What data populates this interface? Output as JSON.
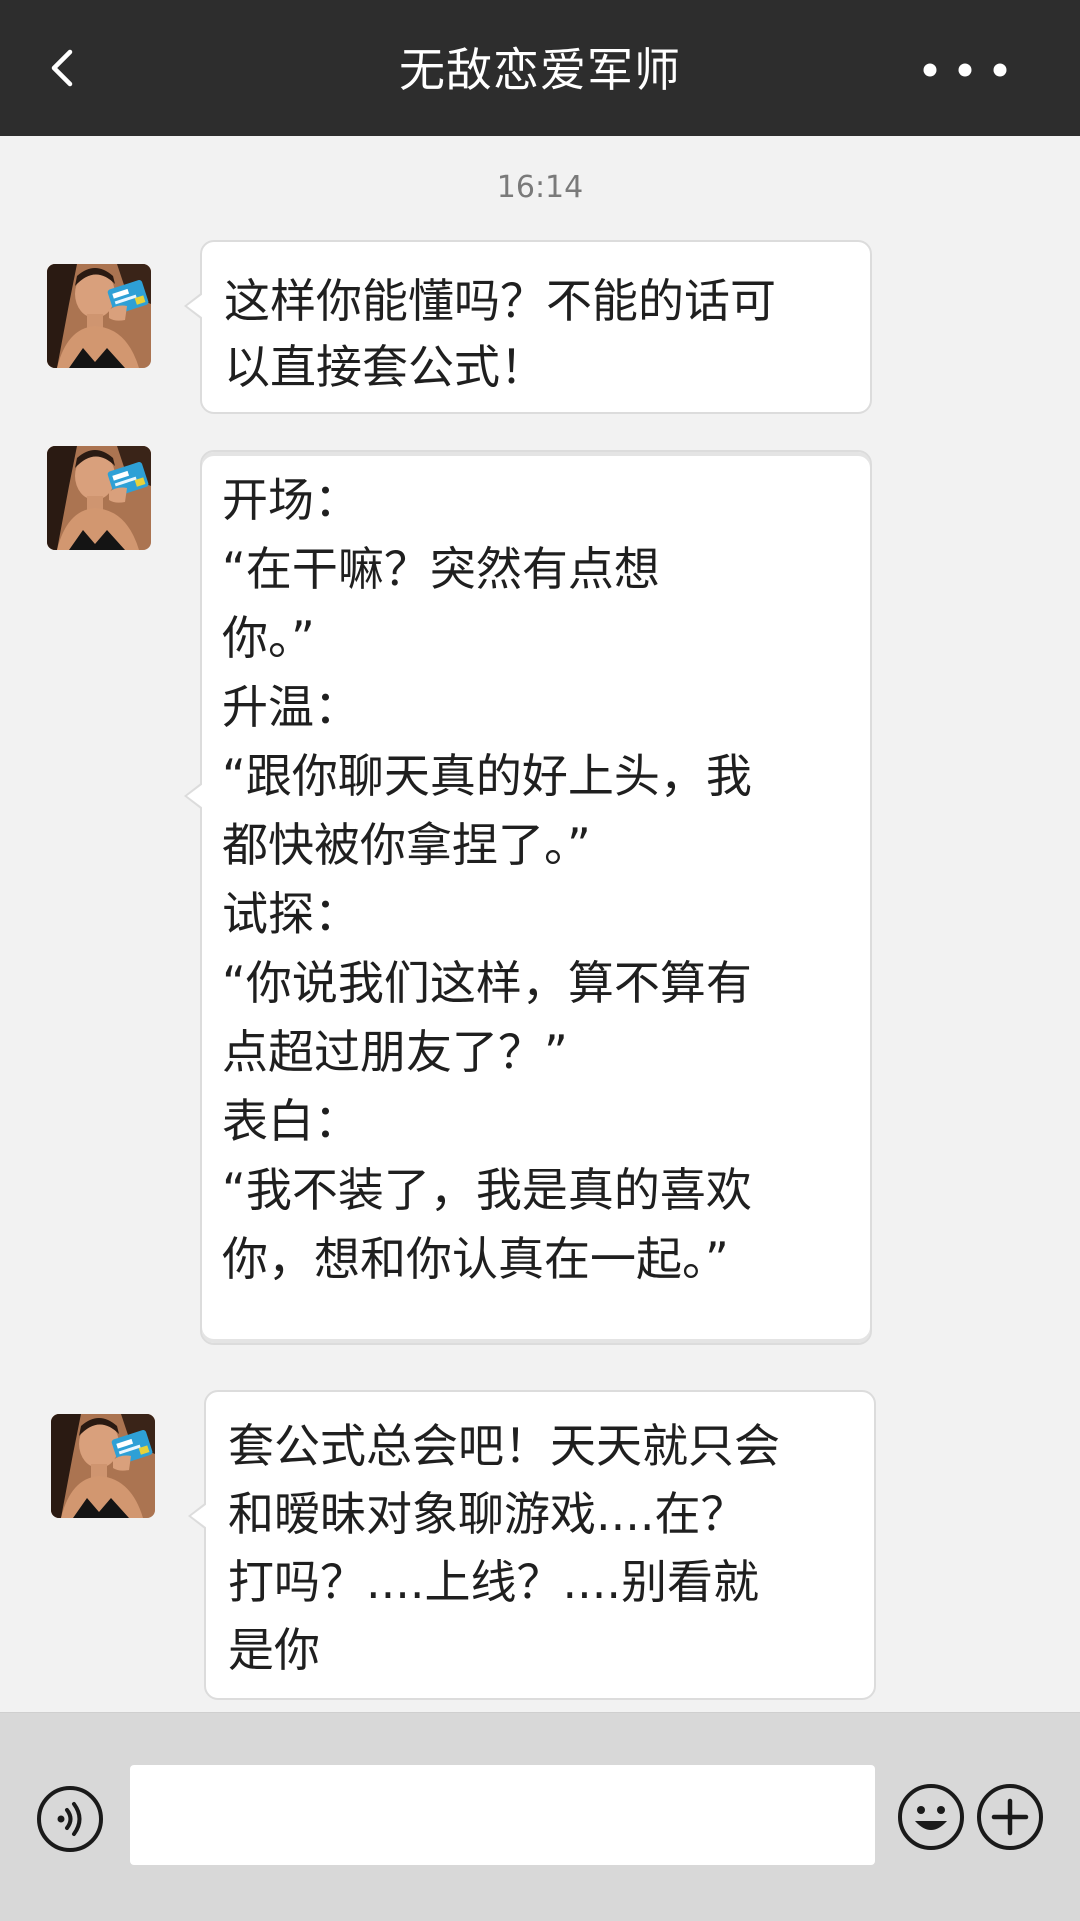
{
  "header": {
    "title": "无敌恋爱军师",
    "back_icon": "chevron-left-icon",
    "more_icon": "more-dots-icon"
  },
  "chat": {
    "timestamp": "16:14",
    "messages": [
      {
        "sender": "contact",
        "lines": [
          "这样你能懂吗？不能的话可",
          "以直接套公式！"
        ]
      },
      {
        "sender": "contact",
        "lines": [
          "开场：",
          "“在干嘛？突然有点想",
          "你。”",
          "升温：",
          "“跟你聊天真的好上头，我",
          "都快被你拿捏了。”",
          "试探：",
          "“你说我们这样，算不算有",
          "点超过朋友了？”",
          "表白：",
          "“我不装了，我是真的喜欢",
          "你，想和你认真在一起。”"
        ]
      },
      {
        "sender": "contact",
        "lines": [
          "套公式总会吧！天天就只会",
          "和暧昧对象聊游戏....在？",
          "打吗？....上线？....别看就",
          "是你"
        ]
      }
    ]
  },
  "input_bar": {
    "value": "",
    "voice_icon": "voice-icon",
    "emoji_icon": "emoji-icon",
    "plus_icon": "plus-icon"
  },
  "colors": {
    "header_bg": "#2d2d2d",
    "chat_bg": "#f2f2f2",
    "bubble_bg": "#ffffff",
    "input_bar_bg": "#d8d8d8"
  }
}
